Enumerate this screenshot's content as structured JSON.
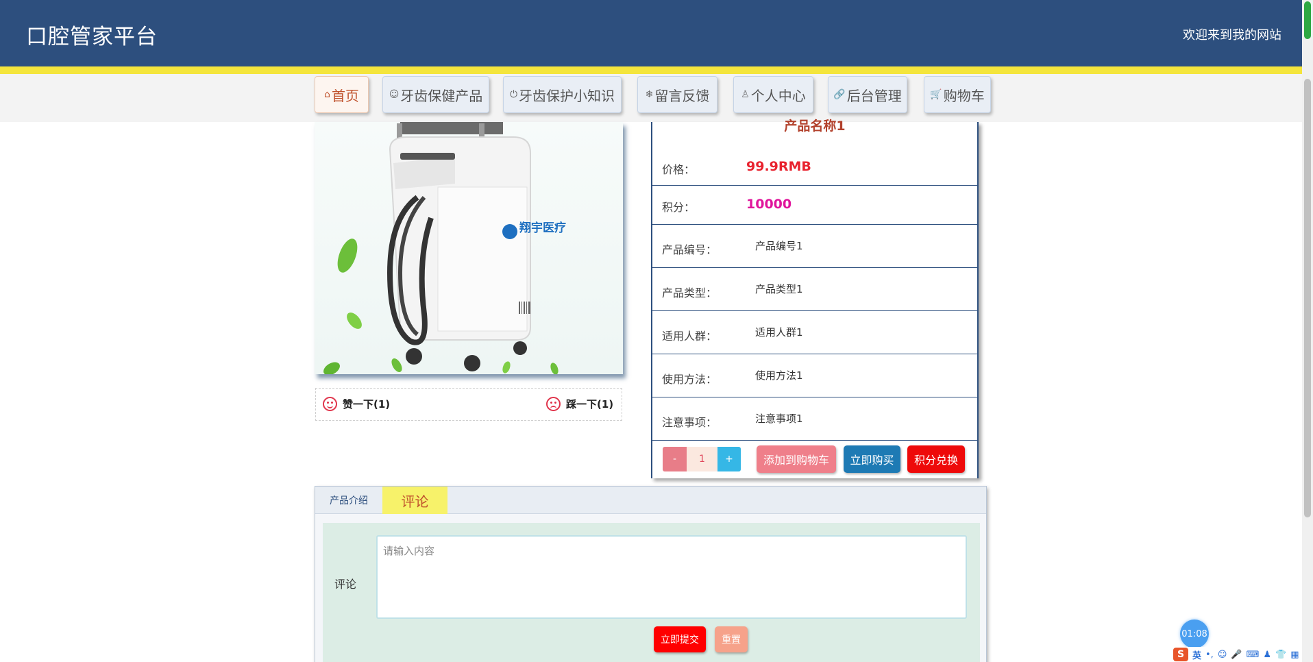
{
  "header": {
    "site_title": "口腔管家平台",
    "welcome": "欢迎来到我的网站"
  },
  "nav": [
    {
      "icon": "home-icon",
      "glyph": "⌂",
      "label": "首页",
      "active": true
    },
    {
      "icon": "smiley-icon",
      "glyph": "☺",
      "label": "牙齿保健产品"
    },
    {
      "icon": "power-icon",
      "glyph": "⏻",
      "label": "牙齿保护小知识"
    },
    {
      "icon": "snowflake-icon",
      "glyph": "❄",
      "label": "留言反馈"
    },
    {
      "icon": "user-icon",
      "glyph": "♙",
      "label": "个人中心"
    },
    {
      "icon": "link-icon",
      "glyph": "🔗",
      "label": "后台管理"
    },
    {
      "icon": "cart-icon",
      "glyph": "🛒",
      "label": "购物车"
    }
  ],
  "product": {
    "name": "产品名称1",
    "brand_text": "翔宇医疗",
    "rows": [
      {
        "label": "价格：",
        "value": "99.9RMB",
        "style": "price"
      },
      {
        "label": "积分：",
        "value": "10000",
        "style": "points"
      },
      {
        "label": "产品编号：",
        "value": "产品编号1"
      },
      {
        "label": "产品类型：",
        "value": "产品类型1"
      },
      {
        "label": "适用人群：",
        "value": "适用人群1"
      },
      {
        "label": "使用方法：",
        "value": "使用方法1"
      },
      {
        "label": "注意事项：",
        "value": "注意事项1"
      }
    ],
    "quantity": {
      "minus": "-",
      "value": "1",
      "plus": "+"
    },
    "actions": {
      "add_to_cart": "添加到购物车",
      "buy_now": "立即购买",
      "points_exchange": "积分兑换"
    },
    "votes": {
      "like": "赞一下(1)",
      "dislike": "踩一下(1)"
    }
  },
  "tabs": {
    "intro": "产品介绍",
    "comment": "评论"
  },
  "comment_form": {
    "label": "评论",
    "placeholder": "请输入内容",
    "submit": "立即提交",
    "reset": "重置"
  },
  "widgets": {
    "timer": "01:08",
    "ime_lang": "英"
  },
  "colors": {
    "header_bg": "#2d4f7e",
    "accent_yellow": "#f4e53c",
    "price_red": "#e8222e",
    "points_magenta": "#e0159c"
  }
}
